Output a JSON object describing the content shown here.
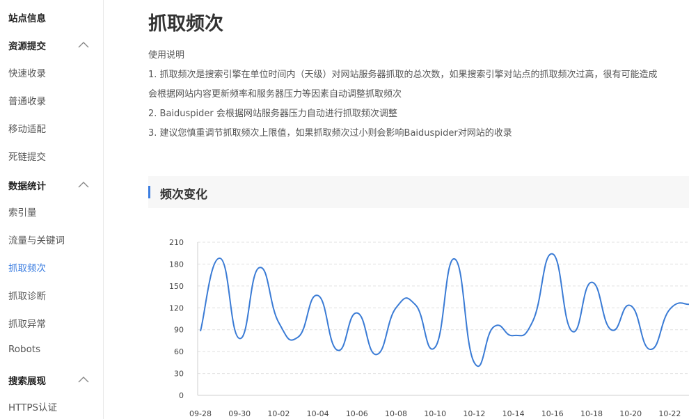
{
  "sidebar": {
    "site_info": "站点信息",
    "groups": [
      {
        "label": "资源提交",
        "items": [
          "快速收录",
          "普通收录",
          "移动适配",
          "死链提交"
        ]
      },
      {
        "label": "数据统计",
        "items": [
          "索引量",
          "流量与关键词",
          "抓取频次",
          "抓取诊断",
          "抓取异常",
          "Robots"
        ]
      },
      {
        "label": "搜索展现",
        "items": [
          "HTTPS认证"
        ]
      }
    ],
    "active_item": "抓取频次"
  },
  "main": {
    "title": "抓取频次",
    "usage_heading": "使用说明",
    "usage_lines": [
      "1. 抓取频次是搜索引擎在单位时间内（天级）对网站服务器抓取的总次数，如果搜索引擎对站点的抓取频次过高，很有可能造成",
      "会根据网站内容更新频率和服务器压力等因素自动调整抓取频次",
      "2. Baiduspider 会根据网站服务器压力自动进行抓取频次调整",
      "3. 建议您慎重调节抓取频次上限值，如果抓取频次过小则会影响Baiduspider对网站的收录"
    ],
    "section_title": "频次变化"
  },
  "colors": {
    "accent": "#3b7de0",
    "line": "#3a7bd5"
  },
  "chart_data": {
    "type": "line",
    "x": [
      "09-28",
      "09-29",
      "09-30",
      "10-01",
      "10-02",
      "10-03",
      "10-04",
      "10-05",
      "10-06",
      "10-07",
      "10-08",
      "10-09",
      "10-10",
      "10-11",
      "10-12",
      "10-13",
      "10-14",
      "10-15",
      "10-16",
      "10-17",
      "10-18",
      "10-19",
      "10-20",
      "10-21",
      "10-22",
      "10-23"
    ],
    "x_tick_labels": [
      "09-28",
      "09-30",
      "10-02",
      "10-04",
      "10-06",
      "10-08",
      "10-10",
      "10-12",
      "10-14",
      "10-16",
      "10-18",
      "10-20",
      "10-22"
    ],
    "series": [
      {
        "values": [
          88,
          188,
          78,
          175,
          100,
          80,
          137,
          62,
          113,
          56,
          120,
          124,
          66,
          187,
          45,
          94,
          82,
          102,
          194,
          88,
          155,
          90,
          123,
          63,
          118,
          125
        ]
      }
    ],
    "ylim": [
      0,
      210
    ],
    "y_ticks": [
      0,
      30,
      60,
      90,
      120,
      150,
      180,
      210
    ],
    "grid": true,
    "legend": "none"
  }
}
